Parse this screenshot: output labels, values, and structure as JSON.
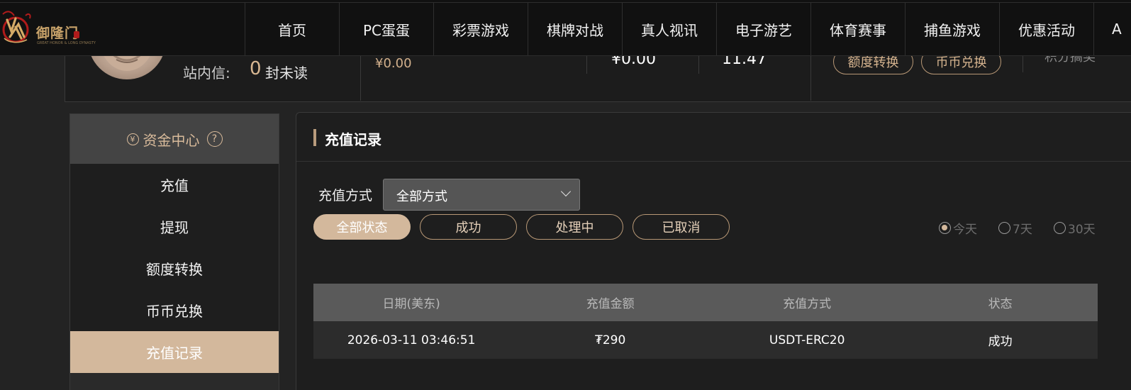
{
  "brand": {
    "name": "御隆门",
    "subtitle": "GREAT HONOR & LONG DYNASTY",
    "accent": "#c9a36a"
  },
  "nav": {
    "items": [
      "首页",
      "PC蛋蛋",
      "彩票游戏",
      "棋牌对战",
      "真人视讯",
      "电子游艺",
      "体育赛事",
      "捕鱼游戏",
      "优惠活动",
      "A"
    ]
  },
  "user": {
    "messages_label": "站内信:",
    "messages_count": "0",
    "messages_unread": "封未读",
    "balance_1": "¥0.00",
    "balance_2": "¥0.00",
    "balance_3": "11.47",
    "transfer_button": "额度转换",
    "exchange_button": "币币兑换",
    "points_partial": "积分搞奖"
  },
  "sidebar": {
    "header": "资金中心",
    "items": [
      "充值",
      "提现",
      "额度转换",
      "币币兑换",
      "充值记录"
    ],
    "active_index": 4
  },
  "content": {
    "title": "充值记录",
    "method_label": "充值方式",
    "method_value": "全部方式",
    "status_filters": [
      "全部状态",
      "成功",
      "处理中",
      "已取消"
    ],
    "active_status_index": 0,
    "range_options": [
      "今天",
      "7天",
      "30天"
    ],
    "range_selected_index": 0,
    "table": {
      "columns": [
        "日期(美东)",
        "充值金额",
        "充值方式",
        "状态"
      ],
      "rows": [
        [
          "2026-03-11 03:46:51",
          "₮290",
          "USDT-ERC20",
          "成功"
        ]
      ]
    }
  },
  "colors": {
    "gold_active": "#d3b89c",
    "gold_border": "#b89876",
    "background": "#232323"
  }
}
